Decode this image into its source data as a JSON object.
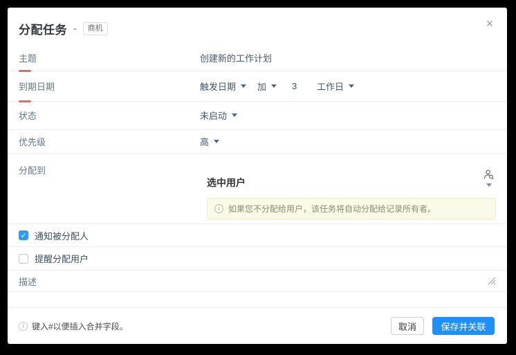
{
  "dialog": {
    "title": "分配任务",
    "title_separator": "-",
    "module_badge": "商机",
    "close_glyph": "×"
  },
  "fields": {
    "subject": {
      "label": "主题",
      "required": true,
      "value": "创建新的工作计划"
    },
    "due_date": {
      "label": "到期日期",
      "required": true,
      "trigger": "触发日期",
      "operator": "加",
      "offset": "3",
      "unit": "工作日"
    },
    "status": {
      "label": "状态",
      "value": "未启动"
    },
    "priority": {
      "label": "优先级",
      "value": "高"
    },
    "assign_to": {
      "label": "分配到",
      "selected_users": "选中用户",
      "info_icon": "i",
      "info_text": "如果您不分配给用户，该任务将自动分配给记录所有者。"
    },
    "notify_assignee": {
      "label": "通知被分配人",
      "checked": true
    },
    "remind_user": {
      "label": "提醒分配用户",
      "checked": false
    },
    "description": {
      "label": "描述"
    }
  },
  "footer": {
    "hint_icon": "i",
    "hint_text": "键入#以便插入合并字段。",
    "cancel_label": "取消",
    "save_label": "保存并关联"
  },
  "colors": {
    "accent_blue": "#1e90f7",
    "checkbox_blue": "#2e9cf7",
    "required_red": "#f5655b",
    "info_box_bg": "#fbfae8",
    "info_box_border": "#eeeccd"
  }
}
